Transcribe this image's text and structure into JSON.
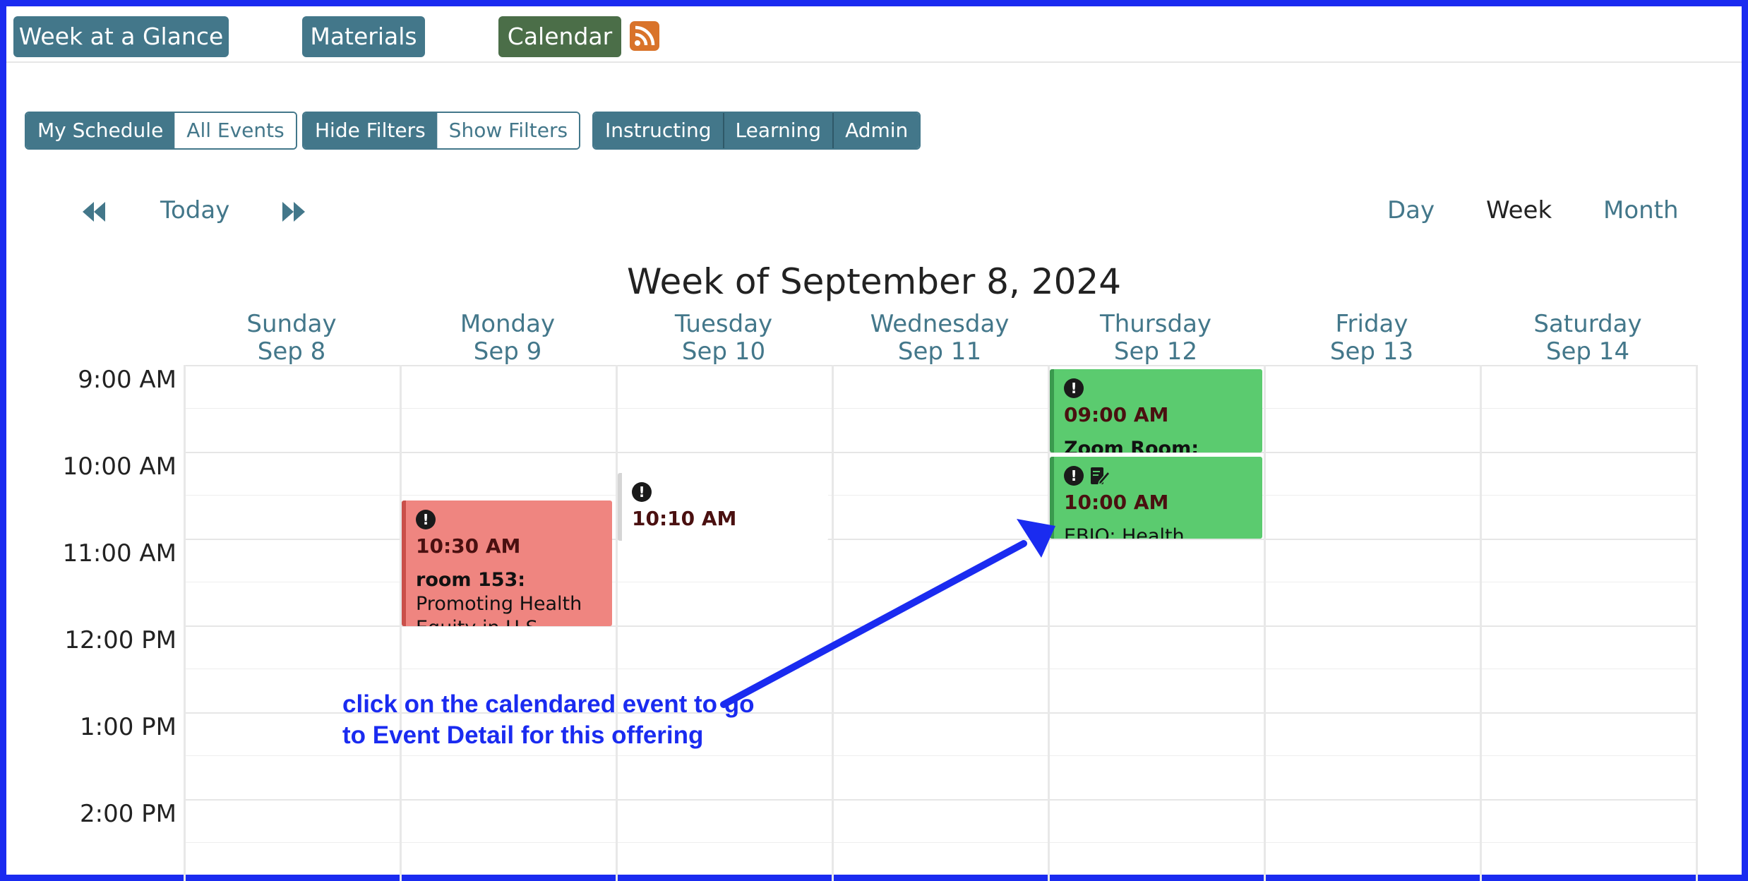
{
  "nav": {
    "week_at_a_glance": "Week at a Glance",
    "materials": "Materials",
    "calendar": "Calendar",
    "rss_icon": "rss-feed-icon"
  },
  "filters": {
    "schedule_group": [
      "My Schedule",
      "All Events"
    ],
    "filter_group": [
      "Hide Filters",
      "Show Filters"
    ],
    "role_group": [
      "Instructing",
      "Learning",
      "Admin"
    ]
  },
  "toolbar": {
    "prev_icon": "double-left-arrow-icon",
    "today": "Today",
    "next_icon": "double-right-arrow-icon",
    "views": [
      "Day",
      "Week",
      "Month"
    ],
    "selected_view": "Week"
  },
  "calendar": {
    "title": "Week of September 8, 2024",
    "days": [
      {
        "name": "Sunday",
        "date": "Sep 8"
      },
      {
        "name": "Monday",
        "date": "Sep 9"
      },
      {
        "name": "Tuesday",
        "date": "Sep 10"
      },
      {
        "name": "Wednesday",
        "date": "Sep 11"
      },
      {
        "name": "Thursday",
        "date": "Sep 12"
      },
      {
        "name": "Friday",
        "date": "Sep 13"
      },
      {
        "name": "Saturday",
        "date": "Sep 14"
      }
    ],
    "times": [
      "9:00 AM",
      "10:00 AM",
      "11:00 AM",
      "12:00 PM",
      "1:00 PM",
      "2:00 PM"
    ],
    "events": [
      {
        "time": "10:30 AM",
        "room": "room 153:",
        "title": "Promoting Health Equity in U.S.",
        "color": "#ef8580"
      },
      {
        "time": "10:10 AM",
        "room": "",
        "title": "",
        "color": "#ffffff"
      },
      {
        "time": "09:00 AM",
        "room": "Zoom Room:",
        "title": "",
        "color": "#5bcb6f"
      },
      {
        "time": "10:00 AM",
        "room": "",
        "title": "EBIO: Health Impact",
        "color": "#5bcb6f"
      }
    ]
  },
  "annotation": {
    "text": "click on the calendared event to go to Event Detail for this offering",
    "color": "#1a2bf0"
  },
  "colors": {
    "primary": "#43778a",
    "calendar_button": "#4b6e48",
    "rss": "#d9732a",
    "frame": "#1a2bf0"
  }
}
